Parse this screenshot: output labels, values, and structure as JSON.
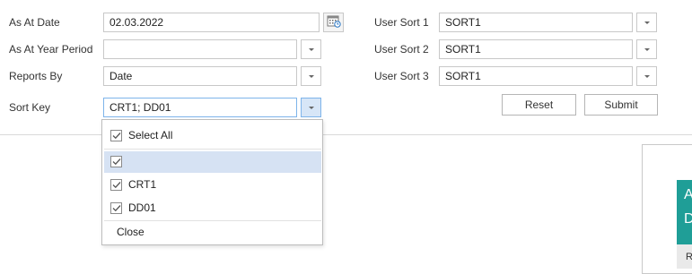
{
  "left_form": {
    "as_at_date": {
      "label": "As At Date",
      "value": "02.03.2022"
    },
    "as_at_year_period": {
      "label": "As At Year Period",
      "value": ""
    },
    "reports_by": {
      "label": "Reports By",
      "value": "Date"
    },
    "sort_key": {
      "label": "Sort Key",
      "value": "CRT1; DD01"
    }
  },
  "right_form": {
    "user_sort_1": {
      "label": "User Sort 1",
      "value": "SORT1"
    },
    "user_sort_2": {
      "label": "User Sort 2",
      "value": "SORT1"
    },
    "user_sort_3": {
      "label": "User Sort 3",
      "value": "SORT1"
    }
  },
  "buttons": {
    "reset": "Reset",
    "submit": "Submit"
  },
  "sort_key_popup": {
    "select_all": {
      "label": "Select All",
      "checked": true
    },
    "items": [
      {
        "label": "",
        "checked": true,
        "highlighted": true
      },
      {
        "label": "CRT1",
        "checked": true,
        "highlighted": false
      },
      {
        "label": "DD01",
        "checked": true,
        "highlighted": false
      }
    ],
    "close": "Close"
  },
  "right_panel": {
    "teal_line_1": "A",
    "teal_line_2": "D",
    "strip_text": "R"
  },
  "colors": {
    "accent_teal": "#1f9e97",
    "selection": "#d6e2f3",
    "active_border": "#7eb4ea"
  }
}
